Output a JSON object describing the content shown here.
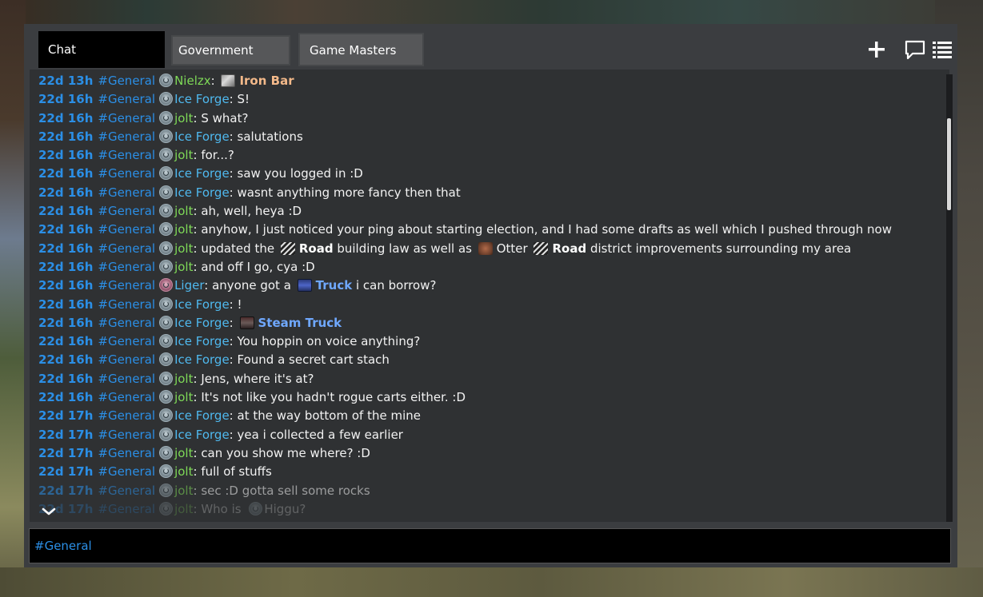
{
  "tabs": [
    {
      "label": "Chat"
    },
    {
      "label": "Government"
    },
    {
      "label": "Game Masters"
    }
  ],
  "icons": {
    "add": "plus-icon",
    "chat": "chat-bubble-icon",
    "list": "list-icon",
    "scroll_down": "chevron-down-icon"
  },
  "messages": [
    {
      "time": "22d 13h",
      "channel": "#General",
      "user": "Nielzx",
      "user_color": "#7ed957",
      "item_icon": "i-ironbar",
      "item": "Iron Bar",
      "item_color": "orange"
    },
    {
      "time": "22d 16h",
      "channel": "#General",
      "user": "Ice Forge",
      "user_color": "#4fb9ef",
      "text": "S!"
    },
    {
      "time": "22d 16h",
      "channel": "#General",
      "user": "jolt",
      "user_color": "#7ed957",
      "text": "S what?"
    },
    {
      "time": "22d 16h",
      "channel": "#General",
      "user": "Ice Forge",
      "user_color": "#4fb9ef",
      "text": "salutations"
    },
    {
      "time": "22d 16h",
      "channel": "#General",
      "user": "jolt",
      "user_color": "#7ed957",
      "text": "for...?"
    },
    {
      "time": "22d 16h",
      "channel": "#General",
      "user": "Ice Forge",
      "user_color": "#4fb9ef",
      "text": "saw you logged in :D"
    },
    {
      "time": "22d 16h",
      "channel": "#General",
      "user": "Ice Forge",
      "user_color": "#4fb9ef",
      "text": "wasnt anything more fancy then that"
    },
    {
      "time": "22d 16h",
      "channel": "#General",
      "user": "jolt",
      "user_color": "#7ed957",
      "text": "ah, well, heya :D"
    },
    {
      "time": "22d 16h",
      "channel": "#General",
      "user": "jolt",
      "user_color": "#7ed957",
      "text": "anyhow, I  just noticed your ping about starting election, and I had some drafts as well which I pushed through now"
    },
    {
      "time": "22d 16h",
      "channel": "#General",
      "user": "jolt",
      "user_color": "#7ed957",
      "rich": true,
      "parts": [
        {
          "t": "updated the "
        },
        {
          "icon": "i-road"
        },
        {
          "b": "Road"
        },
        {
          "t": " building law as well as "
        },
        {
          "icon": "i-otter"
        },
        {
          "t": "Otter "
        },
        {
          "icon": "i-road"
        },
        {
          "b": "Road"
        },
        {
          "t": " district improvements surrounding my area"
        }
      ]
    },
    {
      "time": "22d 16h",
      "channel": "#General",
      "user": "jolt",
      "user_color": "#7ed957",
      "text": "and off I go, cya :D"
    },
    {
      "time": "22d 16h",
      "channel": "#General",
      "user": "Liger",
      "user_color": "#4fb9ef",
      "avatar": "red",
      "rich": true,
      "parts": [
        {
          "t": "anyone got a "
        },
        {
          "icon": "i-truck"
        },
        {
          "blue": "Truck"
        },
        {
          "t": " i can borrow?"
        }
      ]
    },
    {
      "time": "22d 16h",
      "channel": "#General",
      "user": "Ice Forge",
      "user_color": "#4fb9ef",
      "text": "!"
    },
    {
      "time": "22d 16h",
      "channel": "#General",
      "user": "Ice Forge",
      "user_color": "#4fb9ef",
      "rich": true,
      "parts": [
        {
          "icon": "i-steam"
        },
        {
          "blue": "Steam Truck"
        }
      ]
    },
    {
      "time": "22d 16h",
      "channel": "#General",
      "user": "Ice Forge",
      "user_color": "#4fb9ef",
      "text": "You hoppin on voice anything?"
    },
    {
      "time": "22d 16h",
      "channel": "#General",
      "user": "Ice Forge",
      "user_color": "#4fb9ef",
      "text": "Found a secret cart stach"
    },
    {
      "time": "22d 16h",
      "channel": "#General",
      "user": "jolt",
      "user_color": "#7ed957",
      "text": "Jens, where it's at?"
    },
    {
      "time": "22d 16h",
      "channel": "#General",
      "user": "jolt",
      "user_color": "#7ed957",
      "text": "It's not like you hadn't rogue carts either. :D"
    },
    {
      "time": "22d 17h",
      "channel": "#General",
      "user": "Ice Forge",
      "user_color": "#4fb9ef",
      "text": "at the way bottom of the mine"
    },
    {
      "time": "22d 17h",
      "channel": "#General",
      "user": "Ice Forge",
      "user_color": "#4fb9ef",
      "text": "yea i collected a few earlier"
    },
    {
      "time": "22d 17h",
      "channel": "#General",
      "user": "jolt",
      "user_color": "#7ed957",
      "text": "can you show me where? :D"
    },
    {
      "time": "22d 17h",
      "channel": "#General",
      "user": "jolt",
      "user_color": "#7ed957",
      "text": "full of stuffs"
    },
    {
      "time": "22d 17h",
      "channel": "#General",
      "user": "jolt",
      "user_color": "#7ed957",
      "text": "sec :D gotta sell some rocks",
      "fade": 1
    },
    {
      "time": "22d 17h",
      "channel": "#General",
      "user": "jolt",
      "user_color": "#7ed957",
      "rich": true,
      "fade": 2,
      "parts": [
        {
          "t": "Who is "
        },
        {
          "avatar": true
        },
        {
          "t": "Higgu?"
        }
      ]
    }
  ],
  "input": {
    "value": "#General"
  }
}
